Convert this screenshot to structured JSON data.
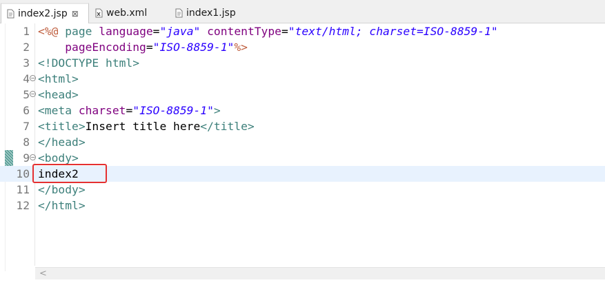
{
  "tabs": [
    {
      "label": "index2.jsp",
      "active": true,
      "close": "⊠"
    },
    {
      "label": "web.xml",
      "active": false
    },
    {
      "label": "index1.jsp",
      "active": false
    }
  ],
  "colors": {
    "tag": "#3c7f7a",
    "jsp_delimiter": "#bf5f3f",
    "attribute": "#7f007f",
    "value": "#2a00ff",
    "current_line": "#e8f2fe",
    "highlight_box": "#e53030"
  },
  "lines": [
    {
      "n": "1",
      "fold": false,
      "tokens": [
        {
          "t": "<%@",
          "c": "jsp"
        },
        {
          "t": " page ",
          "c": "tag"
        },
        {
          "t": "language",
          "c": "attr"
        },
        {
          "t": "=",
          "c": "text"
        },
        {
          "t": "\"java\"",
          "c": "val"
        },
        {
          "t": " ",
          "c": "text"
        },
        {
          "t": "contentType",
          "c": "attr"
        },
        {
          "t": "=",
          "c": "text"
        },
        {
          "t": "\"text/html; charset=ISO-8859-1\"",
          "c": "val"
        }
      ]
    },
    {
      "n": "2",
      "fold": false,
      "tokens": [
        {
          "t": "    ",
          "c": "text"
        },
        {
          "t": "pageEncoding",
          "c": "attr"
        },
        {
          "t": "=",
          "c": "text"
        },
        {
          "t": "\"ISO-8859-1\"",
          "c": "val"
        },
        {
          "t": "%>",
          "c": "jsp"
        }
      ]
    },
    {
      "n": "3",
      "fold": false,
      "tokens": [
        {
          "t": "<!DOCTYPE html>",
          "c": "tag"
        }
      ]
    },
    {
      "n": "4",
      "fold": true,
      "tokens": [
        {
          "t": "<html>",
          "c": "tag"
        }
      ]
    },
    {
      "n": "5",
      "fold": true,
      "tokens": [
        {
          "t": "<head>",
          "c": "tag"
        }
      ]
    },
    {
      "n": "6",
      "fold": false,
      "tokens": [
        {
          "t": "<meta ",
          "c": "tag"
        },
        {
          "t": "charset",
          "c": "attr"
        },
        {
          "t": "=",
          "c": "text"
        },
        {
          "t": "\"ISO-8859-1\"",
          "c": "val"
        },
        {
          "t": ">",
          "c": "tag"
        }
      ]
    },
    {
      "n": "7",
      "fold": false,
      "tokens": [
        {
          "t": "<title>",
          "c": "tag"
        },
        {
          "t": "Insert title here",
          "c": "text"
        },
        {
          "t": "</title>",
          "c": "tag"
        }
      ]
    },
    {
      "n": "8",
      "fold": false,
      "tokens": [
        {
          "t": "</head>",
          "c": "tag"
        }
      ]
    },
    {
      "n": "9",
      "fold": true,
      "tokens": [
        {
          "t": "<body>",
          "c": "tag"
        }
      ]
    },
    {
      "n": "10",
      "fold": false,
      "current": true,
      "tokens": [
        {
          "t": "index2",
          "c": "text"
        }
      ]
    },
    {
      "n": "11",
      "fold": false,
      "tokens": [
        {
          "t": "</body>",
          "c": "tag"
        }
      ]
    },
    {
      "n": "12",
      "fold": false,
      "tokens": [
        {
          "t": "</html>",
          "c": "tag"
        }
      ]
    }
  ],
  "scrollbar": {
    "left_arrow": "<"
  }
}
